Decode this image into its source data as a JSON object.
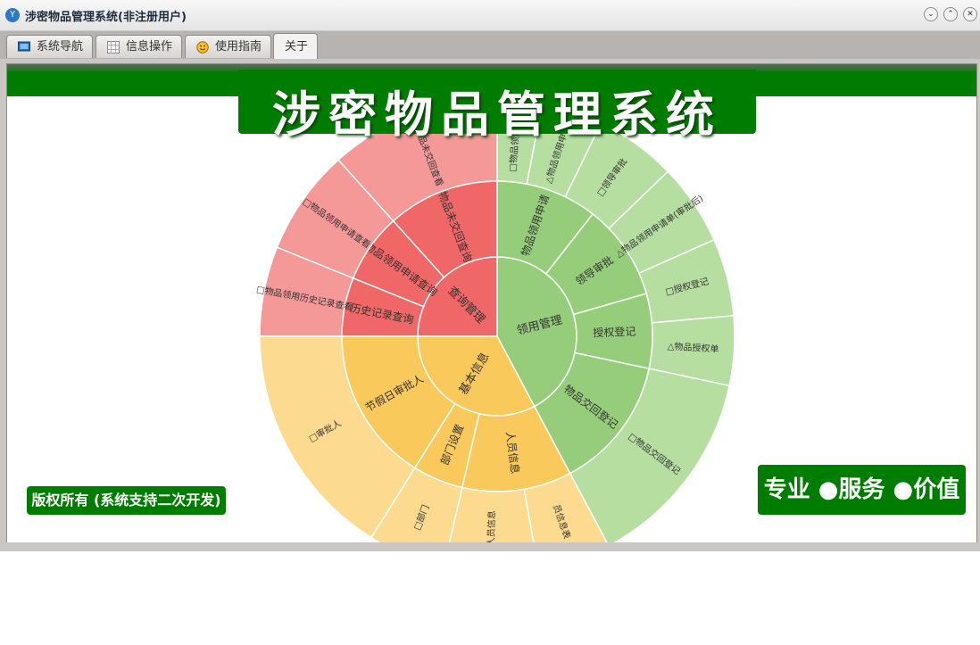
{
  "window": {
    "title": "涉密物品管理系统(非注册用户)",
    "controls": [
      "⌄",
      "⌃",
      "✕"
    ]
  },
  "tabs": [
    {
      "label": "系统导航",
      "icon": "monitor-icon",
      "active": false
    },
    {
      "label": "信息操作",
      "icon": "grid-icon",
      "active": false
    },
    {
      "label": "使用指南",
      "icon": "smiley-icon",
      "active": false
    },
    {
      "label": "关于",
      "icon": "",
      "active": true
    }
  ],
  "about": {
    "banner_title": "涉密物品管理系统",
    "copyright": "版权所有 (系统支持二次开发)",
    "slogan": "专业 ●服务 ●价值"
  },
  "colors": {
    "brand_green": "#007d00",
    "sector_red": "#f06767",
    "sector_red_outer": "#f49898",
    "sector_green": "#96cd7a",
    "sector_green_outer": "#b5dea0",
    "sector_yellow": "#fac95c",
    "sector_yellow_outer": "#fcdb90"
  },
  "chart_data": {
    "type": "sunburst",
    "levels": [
      {
        "name": "领用管理",
        "children": [
          {
            "name": "物品领用申请",
            "children": [
              {
                "name": "□物品领用申请"
              },
              {
                "name": "△物品领用申请单"
              }
            ]
          },
          {
            "name": "领导审批",
            "children": [
              {
                "name": "□领导审批"
              },
              {
                "name": "△物品领用申请单(审批后)"
              }
            ]
          },
          {
            "name": "授权登记",
            "children": [
              {
                "name": "□授权登记"
              },
              {
                "name": "△物品授权单"
              }
            ]
          },
          {
            "name": "物品交回登记",
            "children": [
              {
                "name": "□物品交回登记"
              }
            ]
          }
        ]
      },
      {
        "name": "查询管理",
        "children": [
          {
            "name": "物品未交回查询",
            "children": [
              {
                "name": "□物品未交回查看"
              }
            ]
          },
          {
            "name": "物品领用申请查询",
            "children": [
              {
                "name": "□物品领用申请查看"
              }
            ]
          },
          {
            "name": "历史记录查询",
            "children": [
              {
                "name": "□物品领用历史记录查看"
              }
            ]
          }
        ]
      },
      {
        "name": "基本信息",
        "children": [
          {
            "name": "节假日审批人",
            "children": [
              {
                "name": "□审批人"
              }
            ]
          },
          {
            "name": "部门设置",
            "children": [
              {
                "name": "□部门"
              }
            ]
          },
          {
            "name": "人员信息",
            "children": [
              {
                "name": "员信息表"
              },
              {
                "name": "□人员信息"
              }
            ]
          }
        ]
      }
    ]
  }
}
